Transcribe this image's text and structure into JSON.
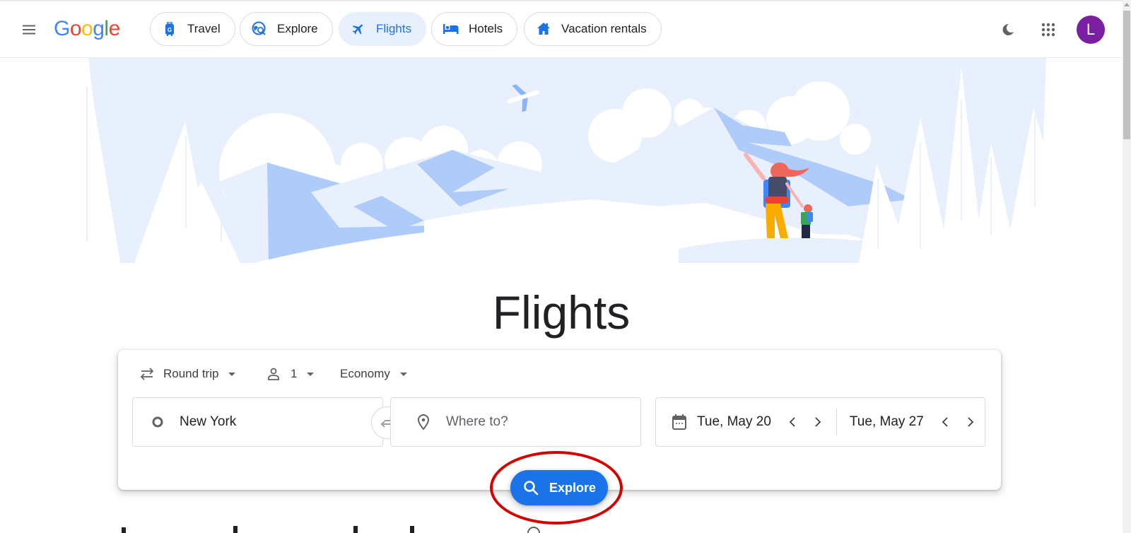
{
  "header": {
    "logo": {
      "letters": [
        "G",
        "o",
        "o",
        "g",
        "l",
        "e"
      ],
      "colors": [
        "#4285f4",
        "#ea4335",
        "#fbbc05",
        "#4285f4",
        "#34a853",
        "#ea4335"
      ]
    },
    "nav": [
      {
        "label": "Travel",
        "icon": "luggage-icon",
        "active": false
      },
      {
        "label": "Explore",
        "icon": "explore-globe-icon",
        "active": false
      },
      {
        "label": "Flights",
        "icon": "airplane-icon",
        "active": true
      },
      {
        "label": "Hotels",
        "icon": "bed-icon",
        "active": false
      },
      {
        "label": "Vacation rentals",
        "icon": "house-icon",
        "active": false
      }
    ],
    "avatar_letter": "L",
    "avatar_color": "#7b1fa2",
    "accent_color": "#1a73e8"
  },
  "page": {
    "title": "Flights"
  },
  "search": {
    "trip_type": "Round trip",
    "passengers": "1",
    "cabin_class": "Economy",
    "origin_value": "New York",
    "destination_placeholder": "Where to?",
    "depart_date": "Tue, May 20",
    "return_date": "Tue, May 27",
    "explore_label": "Explore"
  }
}
